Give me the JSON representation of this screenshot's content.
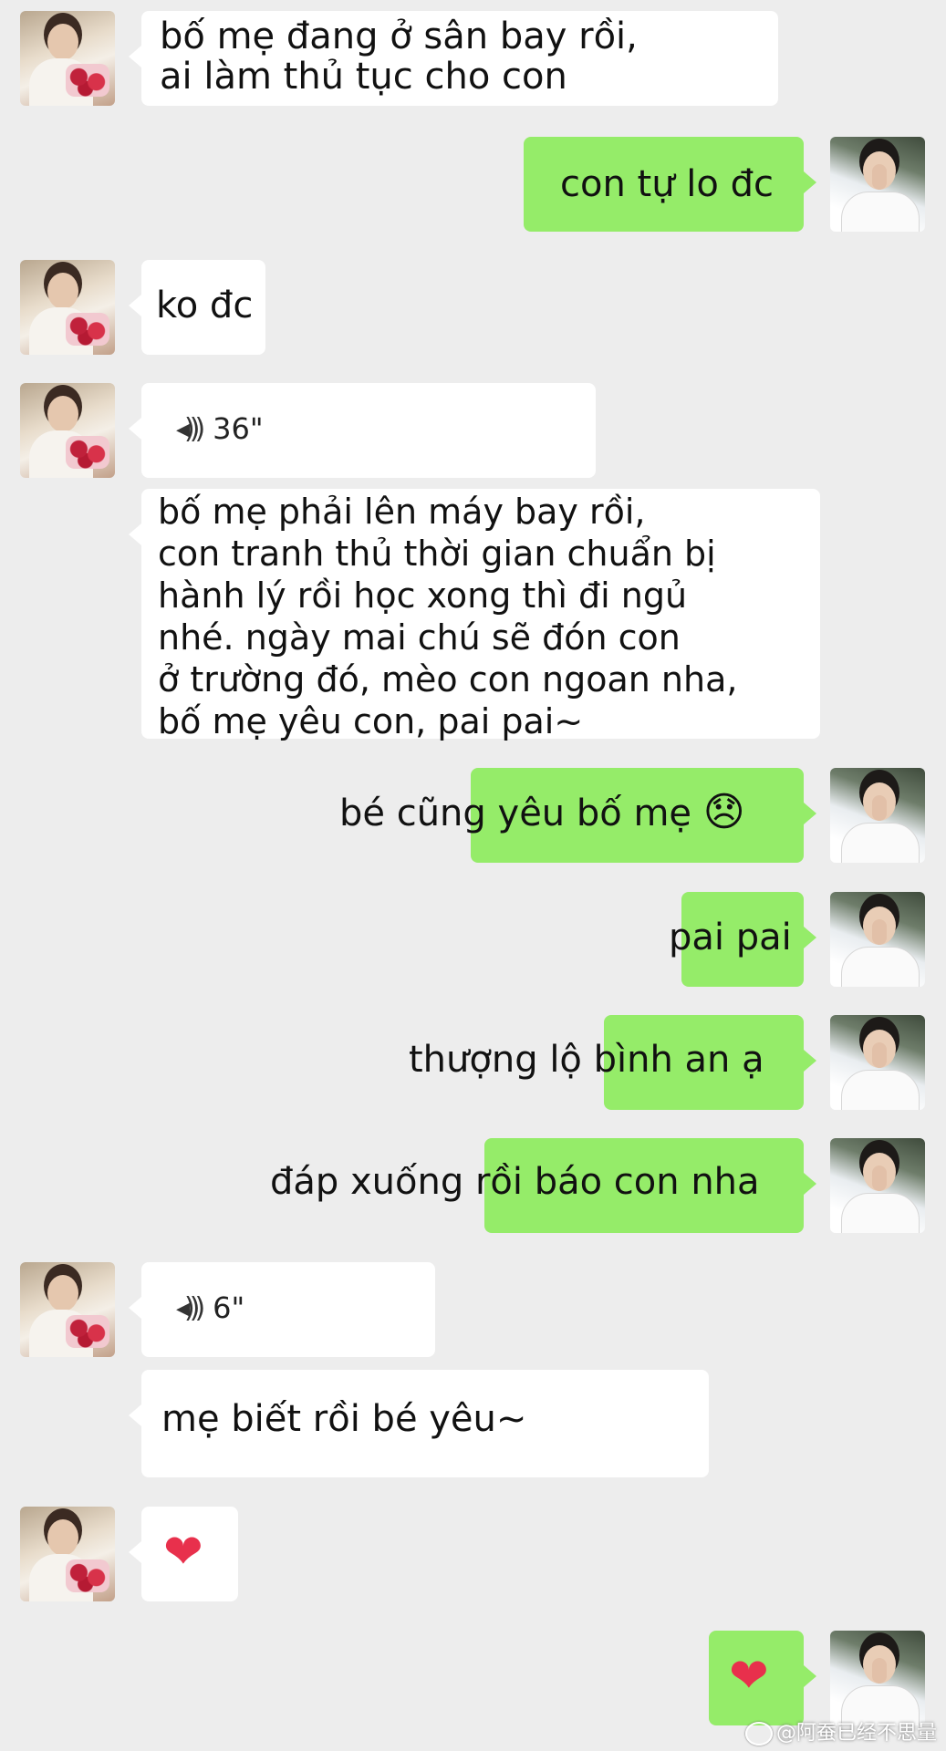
{
  "messages": {
    "m1": "bố mẹ đang ở sân bay rồi,\nai làm thủ tục cho con",
    "m2": "con tự lo đc",
    "m3": "ko đc",
    "m4_duration": "36\"",
    "m5": "bố mẹ phải lên máy bay rồi,\ncon tranh thủ thời gian chuẩn bị\nhành lý rồi học xong thì đi ngủ\nnhé. ngày mai chú sẽ đón con\nở trường đó, mèo con ngoan nha,\nbố mẹ yêu con, pai pai~",
    "m6": "bé cũng yêu bố mẹ",
    "m6_emoji": "😞",
    "m7": "pai pai",
    "m8": "thượng lộ bình an ạ",
    "m9": "đáp xuống rồi báo con nha",
    "m10_duration": "6\"",
    "m11": "mẹ biết rồi bé yêu~",
    "m12_heart": "❤",
    "m13_heart": "❤"
  },
  "icons": {
    "voice": "voice-wave-icon",
    "heart": "heart-icon"
  },
  "watermark": "@阿蚕已经不思量",
  "colors": {
    "incoming_bubble": "#ffffff",
    "outgoing_bubble": "#95ec69",
    "background": "#ededed"
  }
}
